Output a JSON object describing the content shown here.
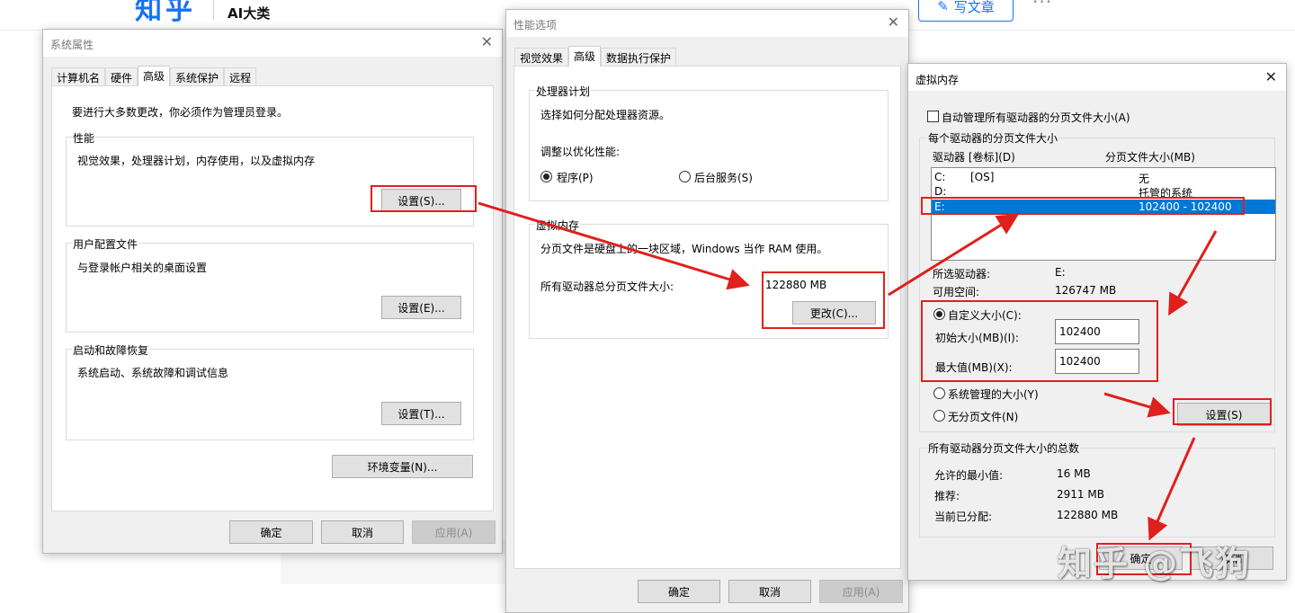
{
  "zhihu": {
    "logo": "知乎",
    "category": "AI大类",
    "write_label": "写文章",
    "more": "···"
  },
  "sysprop": {
    "title": "系统属性",
    "close": "✕",
    "tabs": [
      "计算机名",
      "硬件",
      "高级",
      "系统保护",
      "远程"
    ],
    "admin_note": "要进行大多数更改，你必须作为管理员登录。",
    "perf": {
      "label": "性能",
      "desc": "视觉效果，处理器计划，内存使用，以及虚拟内存",
      "button": "设置(S)..."
    },
    "profile": {
      "label": "用户配置文件",
      "desc": "与登录帐户相关的桌面设置",
      "button": "设置(E)..."
    },
    "startup": {
      "label": "启动和故障恢复",
      "desc": "系统启动、系统故障和调试信息",
      "button": "设置(T)..."
    },
    "env_button": "环境变量(N)...",
    "ok": "确定",
    "cancel": "取消",
    "apply": "应用(A)"
  },
  "perfopt": {
    "title": "性能选项",
    "close": "✕",
    "tabs": [
      "视觉效果",
      "高级",
      "数据执行保护"
    ],
    "cpu": {
      "label": "处理器计划",
      "desc": "选择如何分配处理器资源。",
      "adjust": "调整以优化性能:",
      "opt_programs": "程序(P)",
      "opt_services": "后台服务(S)"
    },
    "vm": {
      "label": "虚拟内存",
      "desc": "分页文件是硬盘上的一块区域，Windows 当作 RAM 使用。",
      "total_label": "所有驱动器总分页文件大小:",
      "total_value": "122880 MB",
      "change_button": "更改(C)..."
    },
    "ok": "确定",
    "cancel": "取消",
    "apply": "应用(A)"
  },
  "vmem": {
    "title": "虚拟内存",
    "close": "✕",
    "auto_manage": "自动管理所有驱动器的分页文件大小(A)",
    "per_drive_label": "每个驱动器的分页文件大小",
    "col_drive": "驱动器 [卷标](D)",
    "col_size": "分页文件大小(MB)",
    "drives": [
      {
        "drive": "C:",
        "label": "[OS]",
        "size": "无"
      },
      {
        "drive": "D:",
        "label": "",
        "size": "托管的系统"
      },
      {
        "drive": "E:",
        "label": "",
        "size": "102400 - 102400"
      }
    ],
    "selected_drive_label": "所选驱动器:",
    "selected_drive_value": "E:",
    "free_space_label": "可用空间:",
    "free_space_value": "126747 MB",
    "custom_size": "自定义大小(C):",
    "initial_label": "初始大小(MB)(I):",
    "initial_value": "102400",
    "max_label": "最大值(MB)(X):",
    "max_value": "102400",
    "system_managed": "系统管理的大小(Y)",
    "no_paging": "无分页文件(N)",
    "set_button": "设置(S)",
    "totals_label": "所有驱动器分页文件大小的总数",
    "min_allowed_label": "允许的最小值:",
    "min_allowed_value": "16 MB",
    "recommended_label": "推荐:",
    "recommended_value": "2911 MB",
    "current_label": "当前已分配:",
    "current_value": "122880 MB",
    "ok": "确定",
    "cancel": "取消"
  },
  "watermark": "知乎 @飞狗",
  "annotation_color": "#e0201c"
}
